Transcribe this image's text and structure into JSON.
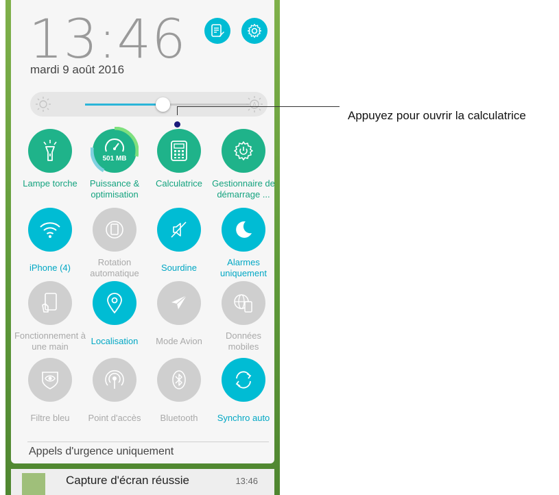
{
  "status": {
    "time": "13:46",
    "date": "mardi 9 août 2016"
  },
  "header_buttons": [
    {
      "icon": "edit-list-icon"
    },
    {
      "icon": "settings-gear-icon"
    }
  ],
  "brightness": {
    "level": 0.47,
    "left_icon": "sun-icon",
    "right_icon": "auto-brightness-icon"
  },
  "tiles": [
    {
      "label": "Lampe torche",
      "state": "green",
      "icon": "flashlight-icon"
    },
    {
      "label": "Puissance & optimisation",
      "state": "green",
      "icon": "speedometer-icon",
      "value": "501 MB"
    },
    {
      "label": "Calculatrice",
      "state": "green",
      "icon": "calculator-icon"
    },
    {
      "label": "Gestionnaire de démarrage ...",
      "state": "green",
      "icon": "gear-power-icon"
    },
    {
      "label": "iPhone (4)",
      "state": "blue",
      "icon": "wifi-icon"
    },
    {
      "label": "Rotation automatique",
      "state": "grey",
      "icon": "rotation-icon"
    },
    {
      "label": "Sourdine",
      "state": "blue",
      "icon": "mute-icon"
    },
    {
      "label": "Alarmes uniquement",
      "state": "blue",
      "icon": "moon-icon"
    },
    {
      "label": "Fonctionnement à une main",
      "state": "grey",
      "icon": "one-hand-icon"
    },
    {
      "label": "Localisation",
      "state": "blue",
      "icon": "location-pin-icon"
    },
    {
      "label": "Mode Avion",
      "state": "grey",
      "icon": "airplane-icon"
    },
    {
      "label": "Données mobiles",
      "state": "grey",
      "icon": "globe-phone-icon"
    },
    {
      "label": "Filtre bleu",
      "state": "grey",
      "icon": "eye-shield-icon"
    },
    {
      "label": "Point d'accès",
      "state": "grey",
      "icon": "hotspot-icon"
    },
    {
      "label": "Bluetooth",
      "state": "grey",
      "icon": "bluetooth-icon"
    },
    {
      "label": "Synchro auto",
      "state": "blue",
      "icon": "sync-icon"
    }
  ],
  "emergency": "Appels d'urgence uniquement",
  "notification": {
    "title": "Capture d'écran réussie",
    "time": "13:46"
  },
  "callout": "Appuyez pour ouvrir la calculatrice",
  "colors": {
    "green": "#1fb38a",
    "blue": "#00bcd4",
    "grey": "#cfcfcf"
  }
}
